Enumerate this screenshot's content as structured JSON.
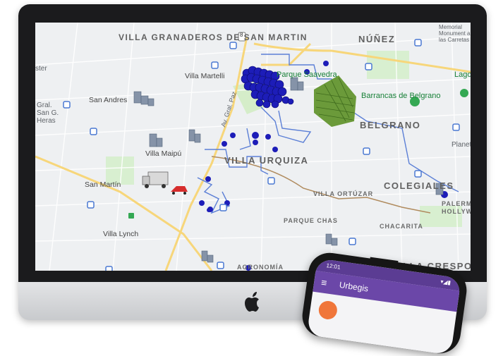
{
  "map": {
    "neighborhoods": [
      {
        "id": "villa-granaderos",
        "text": "VILLA GRANADEROS DE SAN MARTIN"
      },
      {
        "id": "nunez",
        "text": "NÚÑEZ"
      },
      {
        "id": "belgrano",
        "text": "BELGRANO"
      },
      {
        "id": "villa-urquiza",
        "text": "VILLA URQUIZA"
      },
      {
        "id": "colegiales",
        "text": "COLEGIALES"
      },
      {
        "id": "villa-ortuzar",
        "text": "VILLA ORTÚZAR"
      },
      {
        "id": "parque-chas",
        "text": "PARQUE CHAS"
      },
      {
        "id": "chacarita",
        "text": "CHACARITA"
      },
      {
        "id": "villa-crespo",
        "text": "VILLA CRESPO"
      },
      {
        "id": "agronomia",
        "text": "AGRONOMÍA"
      },
      {
        "id": "palermo-hollywood",
        "text": "PALERMO HOLLYWOOD"
      }
    ],
    "places": {
      "villa_martelli": "Villa Martelli",
      "san_andres": "San Andres",
      "villa_maipu": "Villa Maipú",
      "san_martin": "San Martín",
      "villa_lynch": "Villa Lynch",
      "parque_saavedra": "Parque Saavedra",
      "barrancas": "Barrancas de Belgrano",
      "gral_heras": "Gral. San G. Heras",
      "monument": "Memorial Monument a las Carretas",
      "planetarium": "Planet",
      "lago": "Lago",
      "sol": "ster",
      "av_gral_paz": "Av. Gral. Paz"
    },
    "route_shield": "8",
    "colors": {
      "marker": "#1d1db8",
      "route": "#5b7fd6",
      "park": "#c9e9c0",
      "road": "#fbe7a3",
      "stack": "#6b9a3a"
    },
    "icons": [
      "building-icon",
      "truck-icon",
      "car-icon",
      "bus-stop-icon",
      "park-pin-icon",
      "route-shield-icon"
    ]
  },
  "phone": {
    "status_time": "12:01",
    "app_title": "Urbegis"
  }
}
